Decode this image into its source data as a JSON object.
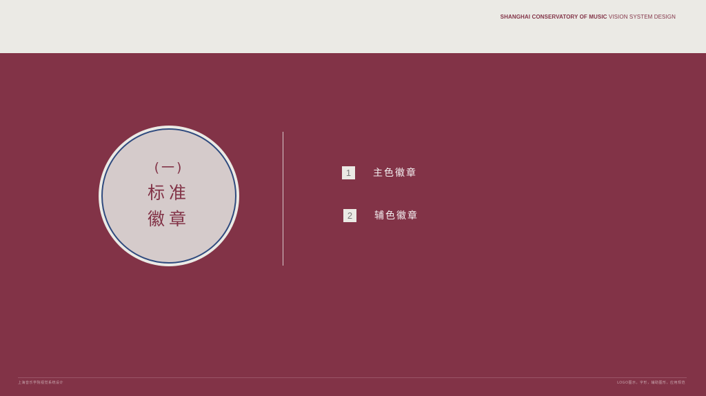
{
  "header": {
    "brand_strong": "SHANGHAI CONSERVATORY OF MUSIC",
    "brand_light": "VISION SYSTEM DESIGN"
  },
  "section": {
    "number": "(一)",
    "title_line1": "标准",
    "title_line2": "徽章"
  },
  "items": [
    {
      "index": "1",
      "label": "主色徽章"
    },
    {
      "index": "2",
      "label": "辅色徽章"
    }
  ],
  "footer": {
    "left": "上海音乐学院视觉系统设计",
    "right": "LOGO图示，字形，辅助图形，应用规范"
  },
  "colors": {
    "primary": "#823347",
    "light": "#ebeae5",
    "ring": "#2f4a7e"
  }
}
